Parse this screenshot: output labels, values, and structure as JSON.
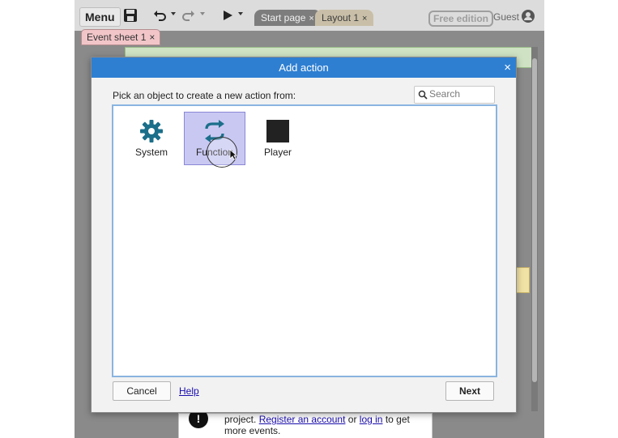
{
  "toolbar": {
    "menu_label": "Menu",
    "icons": [
      "save-icon",
      "undo-icon",
      "redo-icon",
      "play-icon"
    ]
  },
  "tabs": [
    {
      "label": "Start page"
    },
    {
      "label": "Layout 1"
    }
  ],
  "account": {
    "edition_badge": "Free edition",
    "user_label": "Guest"
  },
  "event_sheet_tab": {
    "label": "Event sheet 1"
  },
  "close_glyph": "×",
  "dialog": {
    "title": "Add action",
    "prompt": "Pick an object to create a new action from:",
    "search_placeholder": "Search",
    "objects": [
      {
        "label": "System",
        "icon": "gear-icon",
        "selected": false
      },
      {
        "label": "Function",
        "icon": "function-arrows-icon",
        "selected": true
      },
      {
        "label": "Player",
        "icon": "player-sprite-icon",
        "selected": false
      }
    ],
    "cancel_label": "Cancel",
    "help_label": "Help",
    "next_label": "Next"
  },
  "notice": {
    "text_before": "project.",
    "register_link": "Register an account",
    "or_text": "or",
    "login_link": "log in",
    "text_after": "to get",
    "line2": "more events."
  },
  "colors": {
    "dialog_title_bar": "#2e7fd2",
    "selection": "#c9c8f2",
    "icon_teal": "#1b6f8a"
  }
}
